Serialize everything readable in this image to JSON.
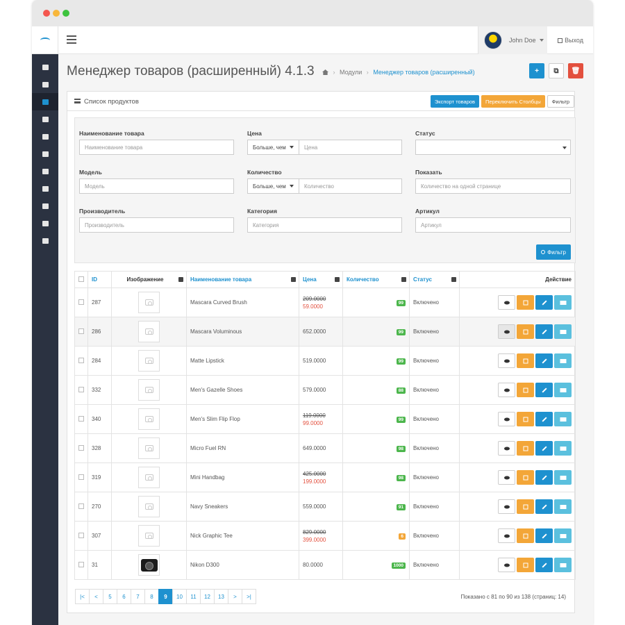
{
  "header": {
    "user_name": "John Doe",
    "logout_label": "Выход"
  },
  "sidebar": {
    "items": [
      {
        "icon": "dashboard-icon",
        "active": false
      },
      {
        "icon": "catalog-icon",
        "active": false
      },
      {
        "icon": "tags-icon",
        "active": true
      },
      {
        "icon": "image-icon",
        "active": false
      },
      {
        "icon": "puzzle-icon",
        "active": false
      },
      {
        "icon": "desktop-icon",
        "active": false
      },
      {
        "icon": "cart-icon",
        "active": false
      },
      {
        "icon": "user-icon",
        "active": false
      },
      {
        "icon": "share-icon",
        "active": false
      },
      {
        "icon": "cog-icon",
        "active": false
      },
      {
        "icon": "bar-chart-icon",
        "active": false
      }
    ]
  },
  "page": {
    "title": "Менеджер товаров (расширенный) 4.1.3",
    "breadcrumb": {
      "modules": "Модули",
      "current": "Менеджер товаров (расширенный)"
    },
    "actions": {
      "add": "+",
      "copy": "⧉",
      "delete": "🗑"
    }
  },
  "panel": {
    "title": "Список продуктов",
    "export_label": "Экспорт товаров",
    "toggle_columns_label": "Переключить Столбцы",
    "filter_label": "Фильтр"
  },
  "filter": {
    "name_label": "Наименование товара",
    "name_placeholder": "Наименование товара",
    "price_label": "Цена",
    "price_op": "Больше, чем",
    "price_placeholder": "Цена",
    "status_label": "Статус",
    "status_value": "",
    "model_label": "Модель",
    "model_placeholder": "Модель",
    "qty_label": "Количество",
    "qty_op": "Больше, чем",
    "qty_placeholder": "Количество",
    "show_label": "Показать",
    "show_placeholder": "Количество на одной странице",
    "manufacturer_label": "Производитель",
    "manufacturer_placeholder": "Производитель",
    "category_label": "Категория",
    "category_placeholder": "Категория",
    "sku_label": "Артикул",
    "sku_placeholder": "Артикул",
    "submit_label": "Фильтр"
  },
  "table": {
    "headers": {
      "id": "ID",
      "image": "Изображение",
      "name": "Наименование товара",
      "price": "Цена",
      "quantity": "Количество",
      "status": "Статус",
      "action": "Действие"
    },
    "rows": [
      {
        "id": "287",
        "image": "placeholder",
        "name": "Mascara Curved Brush",
        "old_price": "209.0000",
        "price": "59.0000",
        "qty": "99",
        "qty_state": "ok",
        "status": "Включено"
      },
      {
        "id": "286",
        "image": "placeholder",
        "name": "Mascara Voluminous",
        "old_price": "",
        "price": "652.0000",
        "qty": "99",
        "qty_state": "ok",
        "status": "Включено"
      },
      {
        "id": "284",
        "image": "placeholder",
        "name": "Matte Lipstick",
        "old_price": "",
        "price": "519.0000",
        "qty": "99",
        "qty_state": "ok",
        "status": "Включено"
      },
      {
        "id": "332",
        "image": "placeholder",
        "name": "Men's Gazelle Shoes",
        "old_price": "",
        "price": "579.0000",
        "qty": "88",
        "qty_state": "ok",
        "status": "Включено"
      },
      {
        "id": "340",
        "image": "placeholder",
        "name": "Men's Slim Flip Flop",
        "old_price": "119.0000",
        "price": "99.0000",
        "qty": "99",
        "qty_state": "ok",
        "status": "Включено"
      },
      {
        "id": "328",
        "image": "placeholder",
        "name": "Micro Fuel RN",
        "old_price": "",
        "price": "649.0000",
        "qty": "98",
        "qty_state": "ok",
        "status": "Включено"
      },
      {
        "id": "319",
        "image": "placeholder",
        "name": "Mini Handbag",
        "old_price": "425.0000",
        "price": "199.0000",
        "qty": "98",
        "qty_state": "ok",
        "status": "Включено"
      },
      {
        "id": "270",
        "image": "placeholder",
        "name": "Navy Sneakers",
        "old_price": "",
        "price": "559.0000",
        "qty": "91",
        "qty_state": "ok",
        "status": "Включено"
      },
      {
        "id": "307",
        "image": "placeholder",
        "name": "Nick Graphic Tee",
        "old_price": "829.0000",
        "price": "399.0000",
        "qty": "6",
        "qty_state": "warn",
        "status": "Включено"
      },
      {
        "id": "31",
        "image": "camera",
        "name": "Nikon D300",
        "old_price": "",
        "price": "80.0000",
        "qty": "1000",
        "qty_state": "ok",
        "status": "Включено"
      }
    ]
  },
  "pagination": {
    "pages": [
      "|<",
      "<",
      "5",
      "6",
      "7",
      "8",
      "9",
      "10",
      "11",
      "12",
      "13",
      ">",
      ">|"
    ],
    "active": "9",
    "summary": "Показано с 81 по 90 из 138 (страниц: 14)"
  },
  "colors": {
    "primary": "#1e91cf",
    "warning": "#f3a638",
    "danger": "#e3503e",
    "success": "#4cb64c",
    "sidebar": "#2b3241"
  }
}
